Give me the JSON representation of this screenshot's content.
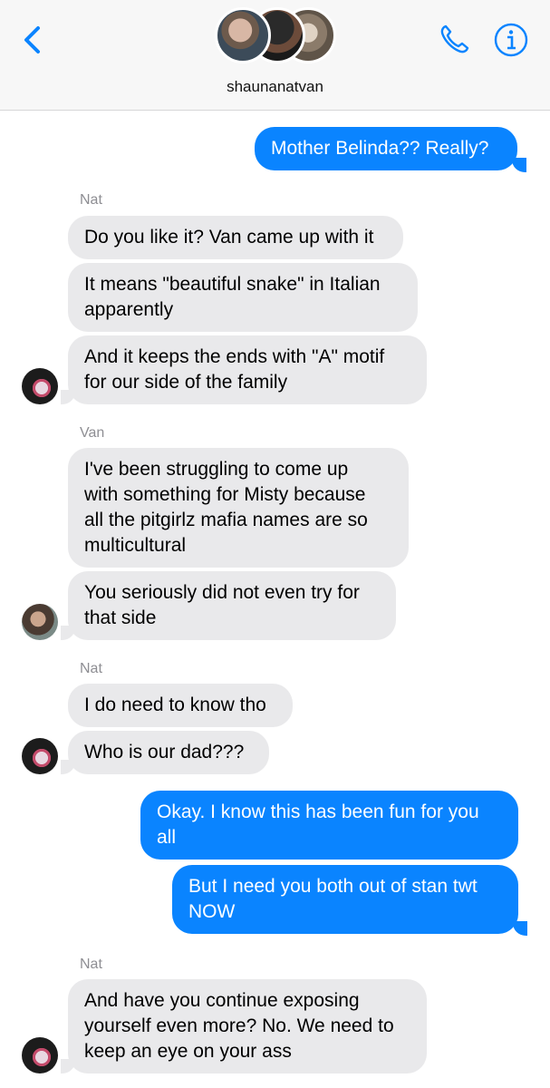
{
  "header": {
    "title": "shaunanatvan",
    "back_icon": "chevron-left-icon",
    "call_icon": "phone-icon",
    "info_icon": "info-icon",
    "accent": "#0a84ff"
  },
  "messages": {
    "m1": "Mother Belinda?? Really?",
    "s1": "Nat",
    "m2": "Do you like it? Van came up with it",
    "m3a": "It means \"beautiful snake\" in Italian",
    "m3b": "apparently",
    "m4a": "And it keeps the ends with \"A\" motif",
    "m4b": "for our side of the family",
    "s2": "Van",
    "m5a": "I've been struggling to come up",
    "m5b": "with something for Misty because",
    "m5c": "all the pitgirlz mafia names are so",
    "m5d": "multicultural",
    "m6a": "You seriously did not even try for",
    "m6b": "that side",
    "s3": "Nat",
    "m7": "I do need to know tho",
    "m8": "Who is our dad???",
    "m9a": "Okay. I know this has been fun for you",
    "m9b": "all",
    "m10a": "But I need you both out of stan twt",
    "m10b": "NOW",
    "s4": "Nat",
    "m11a": "And have you continue exposing",
    "m11b": "yourself even more? No. We need to",
    "m11c": "keep an eye on your ass"
  },
  "colors": {
    "outgoing_bubble": "#0a84ff",
    "incoming_bubble": "#e9e9eb",
    "sender_label": "#8e8e93"
  }
}
